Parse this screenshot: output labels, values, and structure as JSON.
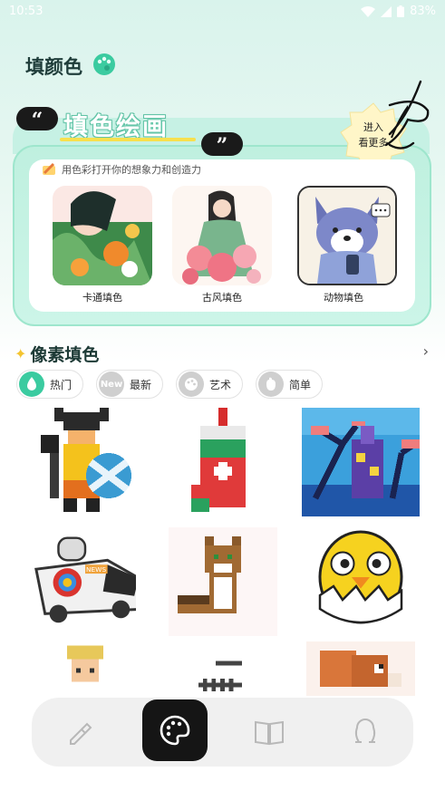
{
  "status_bar": {
    "time": "10:53",
    "battery": "83%"
  },
  "header": {
    "title": "填颜色"
  },
  "banner": {
    "title": "填色绘画",
    "subtitle": "用色彩打开你的想象力和创造力",
    "enter_label_line1": "进入",
    "enter_label_line2": "看更多",
    "categories": [
      {
        "label": "卡通填色"
      },
      {
        "label": "古风填色"
      },
      {
        "label": "动物填色"
      }
    ]
  },
  "pixel_section": {
    "title": "像素填色",
    "chips": [
      {
        "label": "热门",
        "icon": "flame-icon",
        "active": true
      },
      {
        "label": "最新",
        "icon": "new-icon",
        "badge": "New",
        "active": false
      },
      {
        "label": "艺术",
        "icon": "palette-icon",
        "active": false
      },
      {
        "label": "简单",
        "icon": "hand-icon",
        "active": false
      }
    ],
    "tiles": [
      {
        "name": "viking-warrior"
      },
      {
        "name": "christmas-stocking"
      },
      {
        "name": "haunted-castle"
      },
      {
        "name": "news-van"
      },
      {
        "name": "raccoon-cat"
      },
      {
        "name": "chick-in-egg"
      },
      {
        "name": "old-man"
      },
      {
        "name": "fence"
      },
      {
        "name": "squirrel"
      }
    ]
  },
  "van_sign": "NEWS",
  "bottom_nav": [
    {
      "icon": "dropper-icon"
    },
    {
      "icon": "palette-icon",
      "active": true
    },
    {
      "icon": "book-icon"
    },
    {
      "icon": "profile-icon"
    }
  ],
  "colors": {
    "accent": "#3bcba0",
    "banner_bg": "#c6f1e4",
    "nav_active": "#151515"
  }
}
